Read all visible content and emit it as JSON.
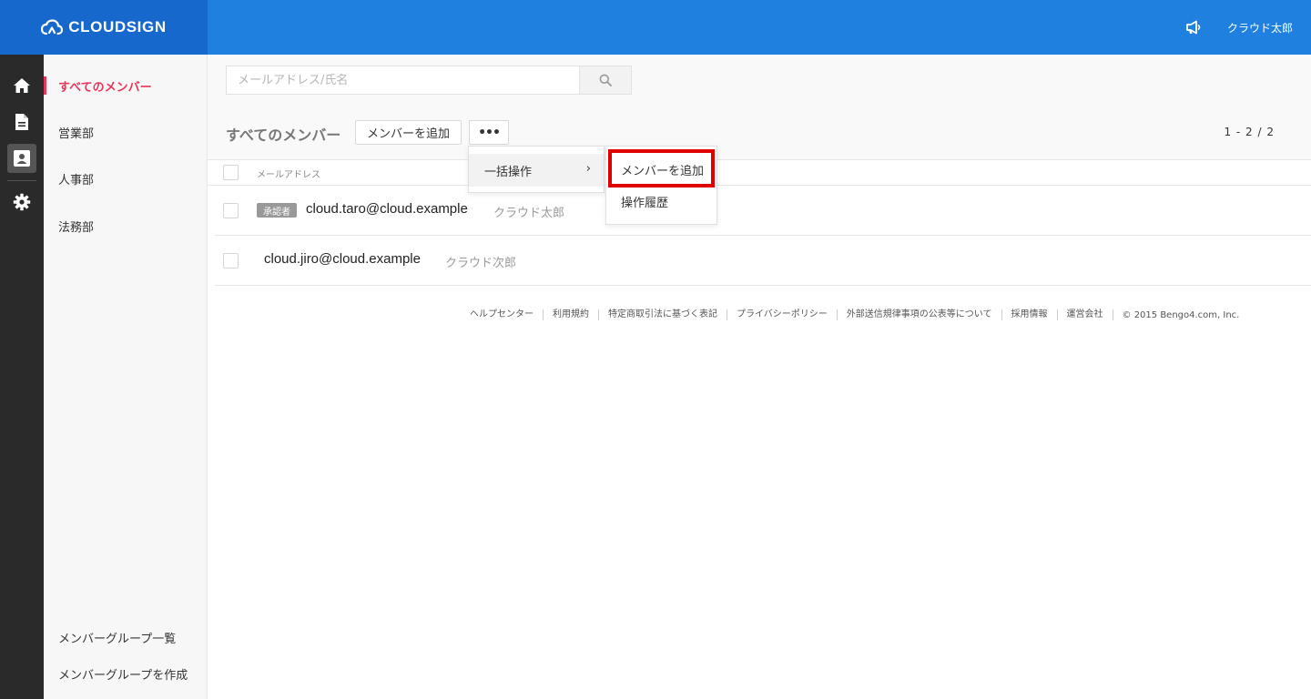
{
  "header": {
    "logo_text": "CLOUDSIGN",
    "user_name": "クラウド太郎",
    "brand_color": "#2080e0"
  },
  "rail": {
    "icons": [
      "home-icon",
      "document-icon",
      "contact-card-icon",
      "gear-icon"
    ]
  },
  "sidebar": {
    "items": [
      {
        "label": "すべてのメンバー",
        "active": true
      },
      {
        "label": "営業部"
      },
      {
        "label": "人事部"
      },
      {
        "label": "法務部"
      }
    ],
    "bottom": [
      {
        "label": "メンバーグループ一覧"
      },
      {
        "label": "メンバーグループを作成"
      }
    ],
    "active_color": "#e8345a"
  },
  "search": {
    "placeholder": "メールアドレス/氏名"
  },
  "main": {
    "title": "すべてのメンバー",
    "add_member_label": "メンバーを追加",
    "more_label": "•••",
    "pagination": "1 - 2 / 2",
    "column_email": "メールアドレス"
  },
  "members": [
    {
      "badge": "承認者",
      "email": "cloud.taro@cloud.example",
      "name": "クラウド太郎"
    },
    {
      "badge": "",
      "email": "cloud.jiro@cloud.example",
      "name": "クラウド次郎"
    }
  ],
  "dropdown": {
    "bulk_label": "一括操作",
    "chevron": "›",
    "submenu": [
      "メンバーを追加",
      "操作履歴"
    ],
    "highlight_color": "#e00000"
  },
  "footer": {
    "links": [
      "ヘルプセンター",
      "利用規約",
      "特定商取引法に基づく表記",
      "プライバシーポリシー",
      "外部送信規律事項の公表等について",
      "採用情報",
      "運営会社"
    ],
    "copyright": "© 2015 Bengo4.com, Inc."
  }
}
